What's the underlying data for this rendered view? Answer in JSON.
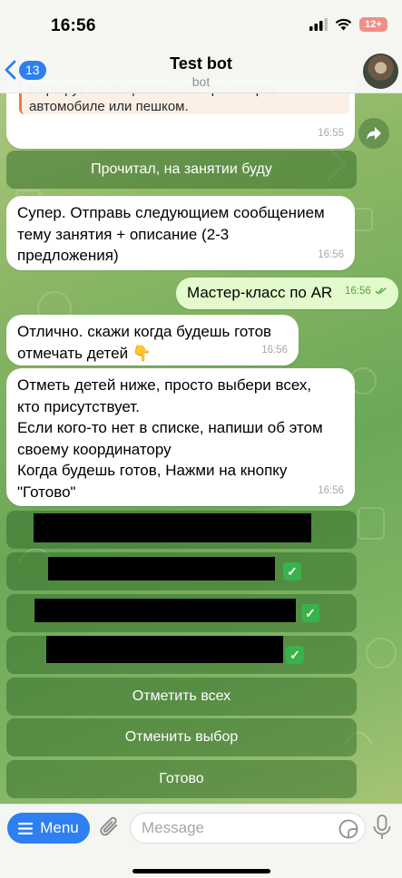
{
  "status_bar": {
    "time": "16:56",
    "battery": "12+"
  },
  "header": {
    "back_count": "13",
    "title": "Test bot",
    "subtitle": "bot"
  },
  "messages": {
    "quoted": {
      "text_line1": "маршрут на общественном транспорте",
      "text_line2": "автомобиле или пешком.",
      "time": "16:55"
    },
    "confirm_button": "Прочитал, на занятии буду",
    "m1": {
      "line1": "Супер. Отправь следующием сообщением",
      "line2": "тему занятия + описание (2-3",
      "line3": "предложения)",
      "time": "16:56"
    },
    "m2_out": {
      "text": "Мастер-класс по AR",
      "time": "16:56"
    },
    "m3": {
      "line1": "Отлично. скажи когда будешь готов",
      "line2": "отмечать детей 👇",
      "time": "16:56"
    },
    "m4": {
      "line1": "Отметь детей ниже, просто выбери всех,",
      "line2": "кто присутствует.",
      "line3": "Если кого-то нет в списке, напиши об этом",
      "line4": "своему координатору",
      "line5": "Когда будешь готов, Нажми на кнопку",
      "line6": "\"Готово\"",
      "time": "16:56"
    }
  },
  "keyboard": {
    "select_all": "Отметить всех",
    "cancel_selection": "Отменить выбор",
    "done": "Готово"
  },
  "input_bar": {
    "menu_label": "Menu",
    "placeholder": "Message"
  },
  "colors": {
    "accent": "#2e7ff0",
    "keyboard_button": "#3a6e30",
    "outgoing_bubble": "#e3fbcc"
  }
}
